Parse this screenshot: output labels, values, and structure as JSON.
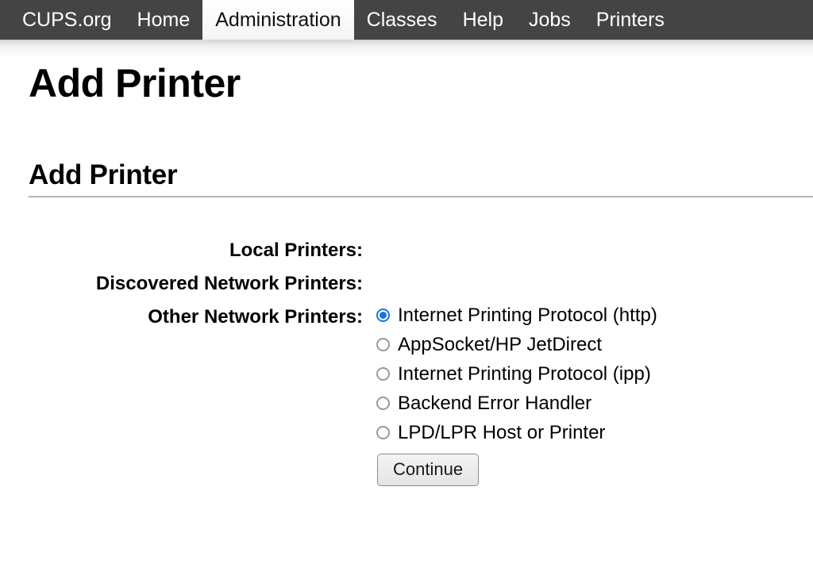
{
  "nav": {
    "items": [
      {
        "label": "CUPS.org",
        "name": "nav-item-cups-org",
        "active": false
      },
      {
        "label": "Home",
        "name": "nav-item-home",
        "active": false
      },
      {
        "label": "Administration",
        "name": "nav-item-administration",
        "active": true
      },
      {
        "label": "Classes",
        "name": "nav-item-classes",
        "active": false
      },
      {
        "label": "Help",
        "name": "nav-item-help",
        "active": false
      },
      {
        "label": "Jobs",
        "name": "nav-item-jobs",
        "active": false
      },
      {
        "label": "Printers",
        "name": "nav-item-printers",
        "active": false
      }
    ],
    "background_color": "#444444",
    "active_background_color": "#fbfbfb",
    "text_color": "#ffffff"
  },
  "page": {
    "title": "Add Printer",
    "section_title": "Add Printer"
  },
  "form": {
    "rows": [
      {
        "label": "Local Printers:",
        "name": "local-printers",
        "value": ""
      },
      {
        "label": "Discovered Network Printers:",
        "name": "discovered-network-printers",
        "value": ""
      },
      {
        "label": "Other Network Printers:",
        "name": "other-network-printers",
        "value": ""
      }
    ],
    "other_network_printers": {
      "options": [
        {
          "label": "Internet Printing Protocol (http)",
          "checked": true
        },
        {
          "label": "AppSocket/HP JetDirect",
          "checked": false
        },
        {
          "label": "Internet Printing Protocol (ipp)",
          "checked": false
        },
        {
          "label": "Backend Error Handler",
          "checked": false
        },
        {
          "label": "LPD/LPR Host or Printer",
          "checked": false
        }
      ],
      "selected": "Internet Printing Protocol (http)",
      "radio_accent_color": "#1a73e8",
      "radio_unchecked_color": "#9a9a9a"
    },
    "continue_button_label": "Continue"
  }
}
